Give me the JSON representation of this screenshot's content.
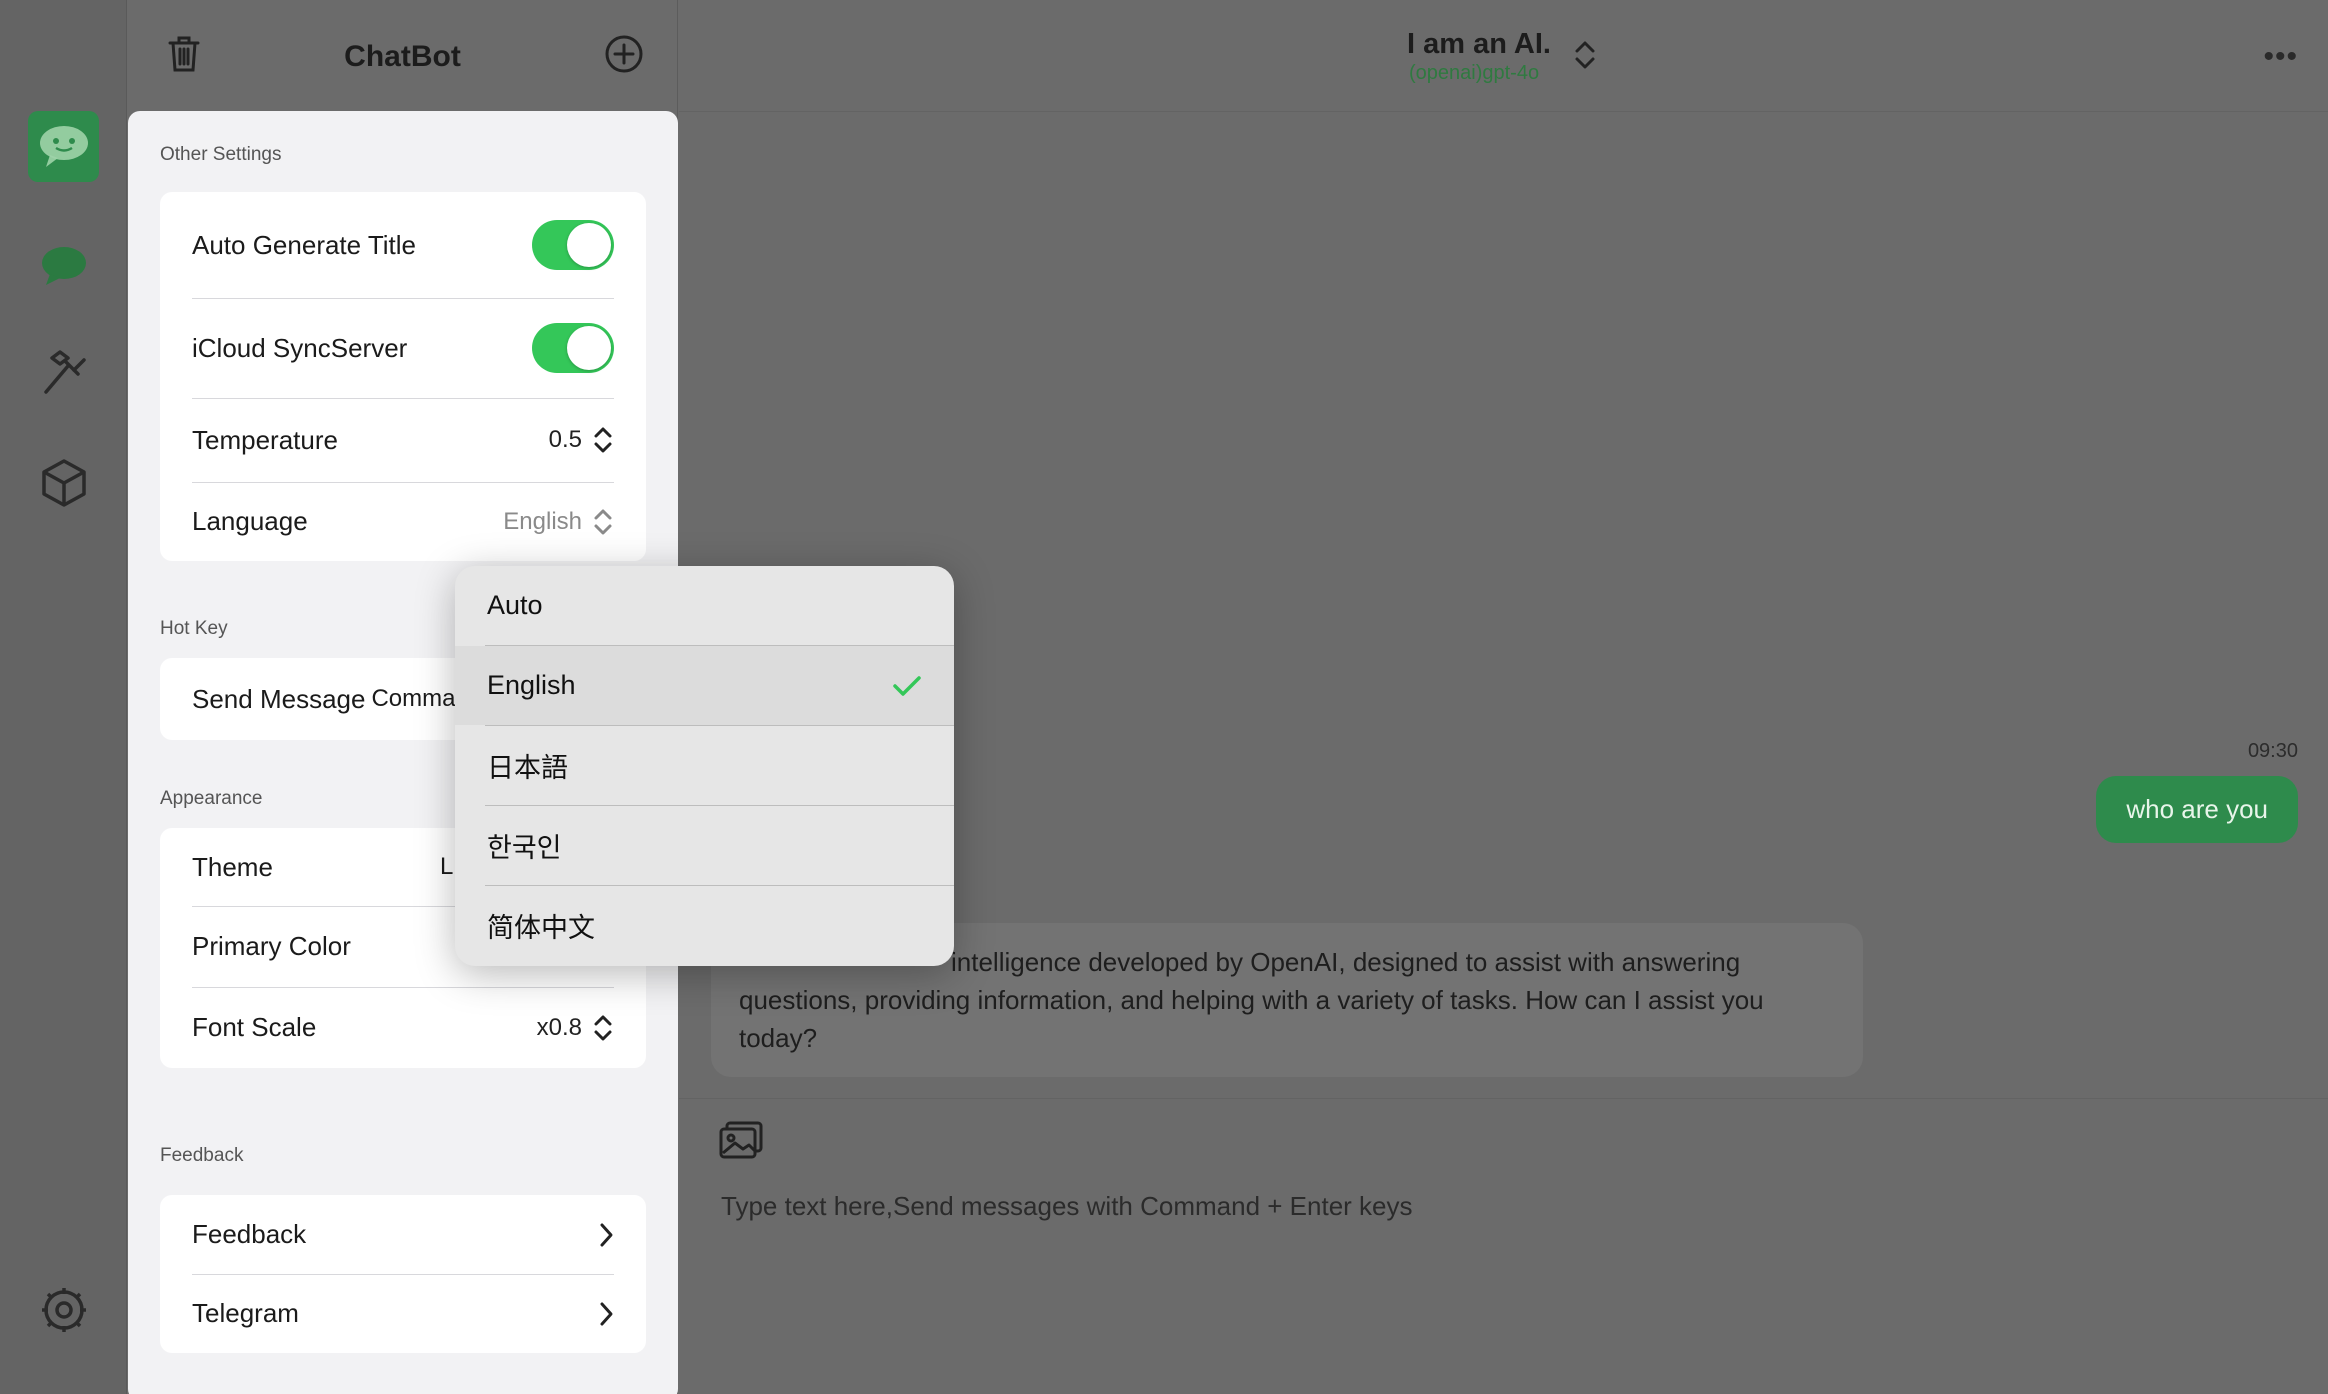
{
  "app": {
    "list_title": "ChatBot",
    "chat_title": "I am an AI.",
    "chat_model": "(openai)gpt-4o"
  },
  "icons": {
    "delete": "trash-icon",
    "new_chat": "plus-circle-icon",
    "chatbot_logo": "chatbot-logo-icon",
    "chat": "chat-bubble-icon",
    "tools": "hammer-icon",
    "models": "cube-icon",
    "settings": "gear-icon",
    "more": "ellipsis-icon",
    "image": "image-attach-icon"
  },
  "colors": {
    "accent": "#2e8b4c",
    "toggle_on": "#34c759",
    "model_text": "#2f7a40"
  },
  "settings": {
    "other_settings_label": "Other Settings",
    "auto_generate_title": {
      "label": "Auto Generate Title",
      "on": true
    },
    "icloud_sync": {
      "label": "iCloud SyncServer",
      "on": true
    },
    "temperature": {
      "label": "Temperature",
      "value": "0.5"
    },
    "language": {
      "label": "Language",
      "value": "English"
    },
    "hotkey_label": "Hot Key",
    "send_message": {
      "label": "Send Message",
      "value": "Comma"
    },
    "appearance_label": "Appearance",
    "theme": {
      "label": "Theme",
      "value": "L"
    },
    "primary_color": {
      "label": "Primary Color"
    },
    "font_scale": {
      "label": "Font Scale",
      "value": "x0.8"
    },
    "feedback_label": "Feedback",
    "feedback_link": {
      "label": "Feedback"
    },
    "telegram_link": {
      "label": "Telegram"
    }
  },
  "language_menu": {
    "options": [
      "Auto",
      "English",
      "日本語",
      "한국인",
      "简体中文"
    ],
    "selected": "English"
  },
  "chat": {
    "time": "09:30",
    "user_message": "who are you",
    "ai_message_visible": "intelligence developed by OpenAI, designed to assist with answering questions, providing information, and helping with a variety of tasks. How can I assist you today?",
    "composer_placeholder": "Type text here,Send messages with Command + Enter keys"
  }
}
